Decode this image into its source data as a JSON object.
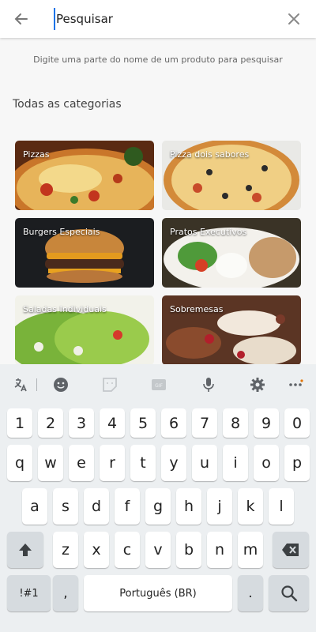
{
  "search": {
    "placeholder": "Pesquisar",
    "hint": "Digite uma parte do nome de um produto para pesquisar"
  },
  "section_title": "Todas as categorias",
  "categories": [
    {
      "label": "Pizzas",
      "image": "pizza-photo"
    },
    {
      "label": "Pizza dois sabores",
      "image": "pizza-two-flavors-photo"
    },
    {
      "label": "Burgers Especiais",
      "image": "burger-photo"
    },
    {
      "label": "Pratos Executivos",
      "image": "executive-dish-photo"
    },
    {
      "label": "Saladas Individuais",
      "image": "salad-photo"
    },
    {
      "label": "Sobremesas",
      "image": "desserts-photo"
    }
  ],
  "keyboard": {
    "toolbar_icons": [
      "translate-icon",
      "emoji-icon",
      "sticker-icon",
      "gif-icon",
      "mic-icon",
      "settings-icon",
      "more-icon"
    ],
    "numbers": [
      "1",
      "2",
      "3",
      "4",
      "5",
      "6",
      "7",
      "8",
      "9",
      "0"
    ],
    "row1": [
      "q",
      "w",
      "e",
      "r",
      "t",
      "y",
      "u",
      "i",
      "o",
      "p"
    ],
    "row2": [
      "a",
      "s",
      "d",
      "f",
      "g",
      "h",
      "j",
      "k",
      "l"
    ],
    "row3": [
      "z",
      "x",
      "c",
      "v",
      "b",
      "n",
      "m"
    ],
    "symbols_label": "!#1",
    "comma": ",",
    "space_label": "Português (BR)",
    "period": "."
  }
}
